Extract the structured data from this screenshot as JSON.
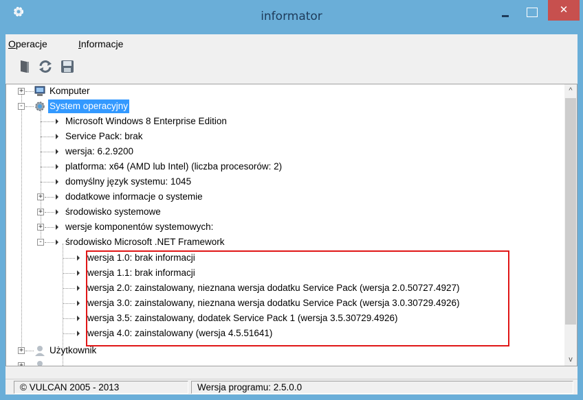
{
  "window": {
    "title": "informator",
    "close_glyph": "✕"
  },
  "menu": {
    "items": [
      {
        "label_first": "O",
        "label_rest": "peracje"
      },
      {
        "label_first": "I",
        "label_rest": "nformacje"
      }
    ]
  },
  "toolbar": {
    "icons": [
      "exit-door-icon",
      "refresh-icon",
      "save-icon"
    ]
  },
  "tree": {
    "computer": "Komputer",
    "system": "System operacyjny",
    "system_children": [
      "Microsoft Windows 8 Enterprise Edition",
      "Service Pack: brak",
      "wersja: 6.2.9200",
      "platforma: x64 (AMD lub Intel) (liczba procesorów: 2)",
      "domyślny język systemu: 1045",
      "dodatkowe informacje o systemie",
      "środowisko systemowe",
      "wersje komponentów systemowych:",
      "środowisko Microsoft .NET Framework"
    ],
    "net_children": [
      "wersja 1.0: brak informacji",
      "wersja 1.1: brak informacji",
      "wersja 2.0: zainstalowany, nieznana wersja dodatku Service Pack (wersja 2.0.50727.4927)",
      "wersja 3.0: zainstalowany, nieznana wersja dodatku Service Pack (wersja 3.0.30729.4926)",
      "wersja 3.5: zainstalowany, dodatek Service Pack 1 (wersja 3.5.30729.4926)",
      "wersja 4.0: zainstalowany (wersja 4.5.51641)"
    ],
    "user": "Użytkownik"
  },
  "scrollbar": {
    "up": "^",
    "down": "v"
  },
  "status": {
    "copyright": "© VULCAN 2005 - 2013",
    "version": "Wersja programu: 2.5.0.0"
  },
  "colors": {
    "titlebar": "#6aaed8",
    "close": "#c7504e",
    "selection": "#3399ff",
    "highlight": "#e01515"
  }
}
